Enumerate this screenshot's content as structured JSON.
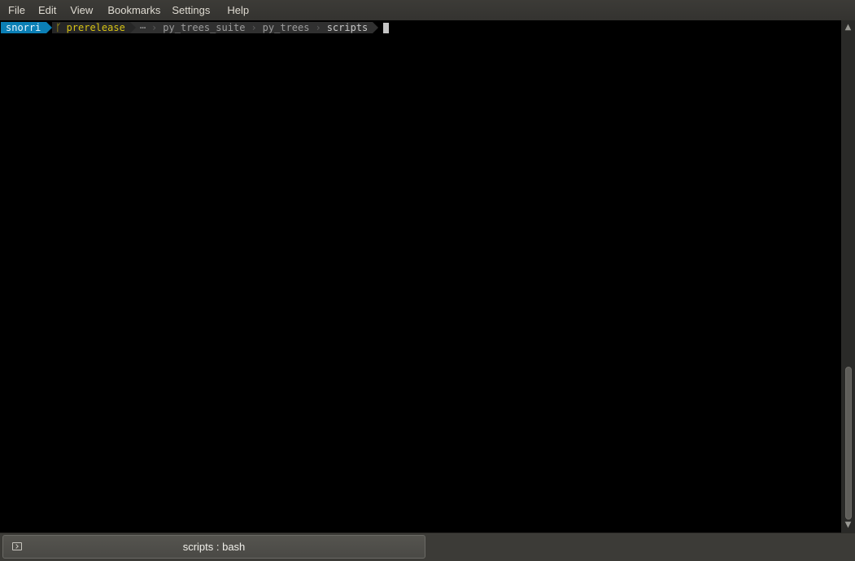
{
  "menubar": {
    "items": [
      "File",
      "Edit",
      "View",
      "Bookmarks",
      "Settings",
      "Help"
    ]
  },
  "prompt": {
    "user": "snorri",
    "branch_icon": "git-branch-icon",
    "branch_glyph": "ᚴ",
    "branch": "prerelease",
    "ellipsis": "⋯",
    "path": [
      "py_trees_suite",
      "py_trees",
      "scripts"
    ],
    "separator": "›"
  },
  "scrollbar": {
    "up_glyph": "▲",
    "down_glyph": "▼",
    "thumb_start_fraction": 0.685,
    "thumb_end_fraction": 1.0
  },
  "tabs": [
    {
      "label": "scripts : bash",
      "icon": "terminal-icon",
      "active": true
    }
  ],
  "colors": {
    "user_segment": "#0b7fb5",
    "branch_text": "#d7c314",
    "path_text": "#9c9c9c",
    "menubar_bg": "#3c3b37",
    "terminal_bg": "#000000"
  }
}
